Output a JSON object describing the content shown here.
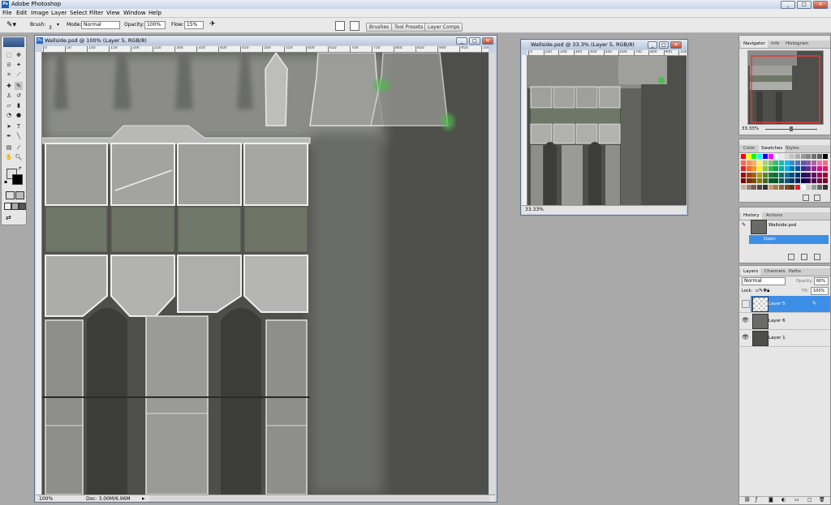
{
  "app": {
    "title": "Adobe Photoshop",
    "icon": "photoshop-icon"
  },
  "window_buttons": [
    "_",
    "□",
    "✕"
  ],
  "menu": [
    "File",
    "Edit",
    "Image",
    "Layer",
    "Select",
    "Filter",
    "View",
    "Window",
    "Help"
  ],
  "options": {
    "brush_label": "Brush:",
    "brush_size": "3",
    "mode_label": "Mode:",
    "mode_value": "Normal",
    "opacity_label": "Opacity:",
    "opacity_value": "100%",
    "flow_label": "Flow:",
    "flow_value": "15%",
    "dock_tabs": [
      "Brushes",
      "Tool Presets",
      "Layer Comps"
    ]
  },
  "doc_main": {
    "title": "Wallside.psd @ 100% (Layer 5, RGB/8)",
    "zoom": "100%",
    "doc_info": "Doc: 3.00M/6.96M",
    "ruler_ticks": [
      "0",
      "50",
      "100",
      "150",
      "200",
      "250",
      "300",
      "350",
      "400",
      "450",
      "500",
      "550",
      "600",
      "650",
      "700",
      "750",
      "800",
      "850",
      "900",
      "950",
      "1000"
    ]
  },
  "doc_small": {
    "title": "Wallside.psd @ 33.3% (Layer 5, RGB/8)",
    "zoom": "33.33%",
    "ruler_ticks": [
      "0",
      "100",
      "200",
      "300",
      "400",
      "500",
      "600",
      "700",
      "800",
      "900",
      "1000"
    ]
  },
  "navigator": {
    "tabs": [
      "Navigator",
      "Info",
      "Histogram"
    ],
    "zoom": "33.33%"
  },
  "swatches_panel": {
    "tabs": [
      "Color",
      "Swatches",
      "Styles"
    ]
  },
  "history": {
    "tabs": [
      "History",
      "Actions"
    ],
    "snapshot": "Wallside.psd",
    "items": [
      "Open"
    ]
  },
  "layers": {
    "tabs": [
      "Layers",
      "Channels",
      "Paths"
    ],
    "blend_mode": "Normal",
    "opacity_label": "Opacity:",
    "opacity_value": "60%",
    "lock_label": "Lock:",
    "fill_label": "Fill:",
    "fill_value": "100%",
    "items": [
      {
        "name": "Layer 5",
        "selected": true
      },
      {
        "name": "Layer 6",
        "selected": false
      },
      {
        "name": "Layer 1",
        "selected": false
      }
    ]
  },
  "colors": {
    "canvas_bg": "#4e4f4a",
    "selection": "#3d8ee6",
    "workspace": "#a9a9a9"
  }
}
